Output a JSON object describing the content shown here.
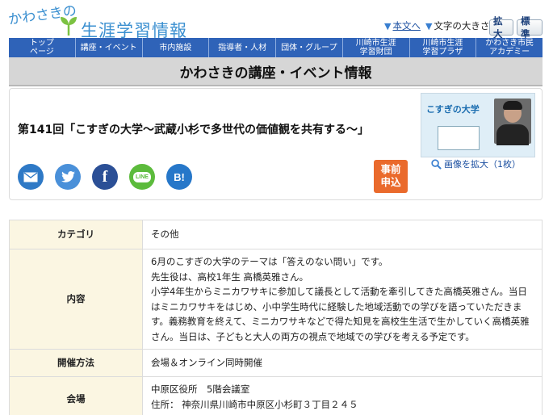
{
  "site": {
    "logo_small": "かわさきの",
    "logo_big": "生涯学習情報"
  },
  "util": {
    "skip_link": "本文へ",
    "text_size_label": "文字の大きさ",
    "enlarge": "拡大",
    "standard": "標準"
  },
  "nav": {
    "items": [
      {
        "label": "トップ\nページ"
      },
      {
        "label": "講座・イベント"
      },
      {
        "label": "市内施設"
      },
      {
        "label": "指導者・人材"
      },
      {
        "label": "団体・グループ"
      },
      {
        "label": "川崎市生涯\n学習財団"
      },
      {
        "label": "川崎市生涯\n学習プラザ"
      },
      {
        "label": "かわさき市民\nアカデミー"
      }
    ]
  },
  "section": {
    "title": "かわさきの講座・イベント情報"
  },
  "event": {
    "title": "第141回「こすぎの大学〜武蔵小杉で多世代の価値観を共有する〜」",
    "apply_label": "事前\n申込",
    "zoom_label": "画像を拡大（1枚）",
    "thumbnail": {
      "title": "こすぎの大学"
    }
  },
  "share": {
    "icons": [
      "mail-icon",
      "twitter-icon",
      "facebook-icon",
      "line-icon",
      "hatena-bookmark-icon"
    ],
    "line_text": "LINE",
    "hatena_text": "B!"
  },
  "details": {
    "category_label": "カテゴリ",
    "category_value": "その他",
    "content_label": "内容",
    "content_lines": [
      "6月のこすぎの大学のテーマは「答えのない問い」です。",
      "先生役は、高校1年生 高橋英雅さん。",
      "小学4年生からミニカワサキに参加して議長として活動を牽引してきた高橋英雅さん。当日はミニカワサキをはじめ、小中学生時代に経験した地域活動での学びを語っていただきます。義務教育を終えて、ミニカワサキなどで得た知見を高校生生活で生かしていく高橋英雅さん。当日は、子どもと大人の両方の視点で地域での学びを考える予定です。"
    ],
    "method_label": "開催方法",
    "method_value": "会場＆オンライン同時開催",
    "venue_label": "会場",
    "venue_name": "中原区役所　5階会議室",
    "venue_address": "住所：  神奈川県川崎市中原区小杉町３丁目２４５"
  },
  "colors": {
    "nav_bg": "#2f63b8",
    "apply_bg": "#ea6a2c",
    "label_cell_bg": "#fbf6e2",
    "logo_blue": "#3a8fd0"
  }
}
